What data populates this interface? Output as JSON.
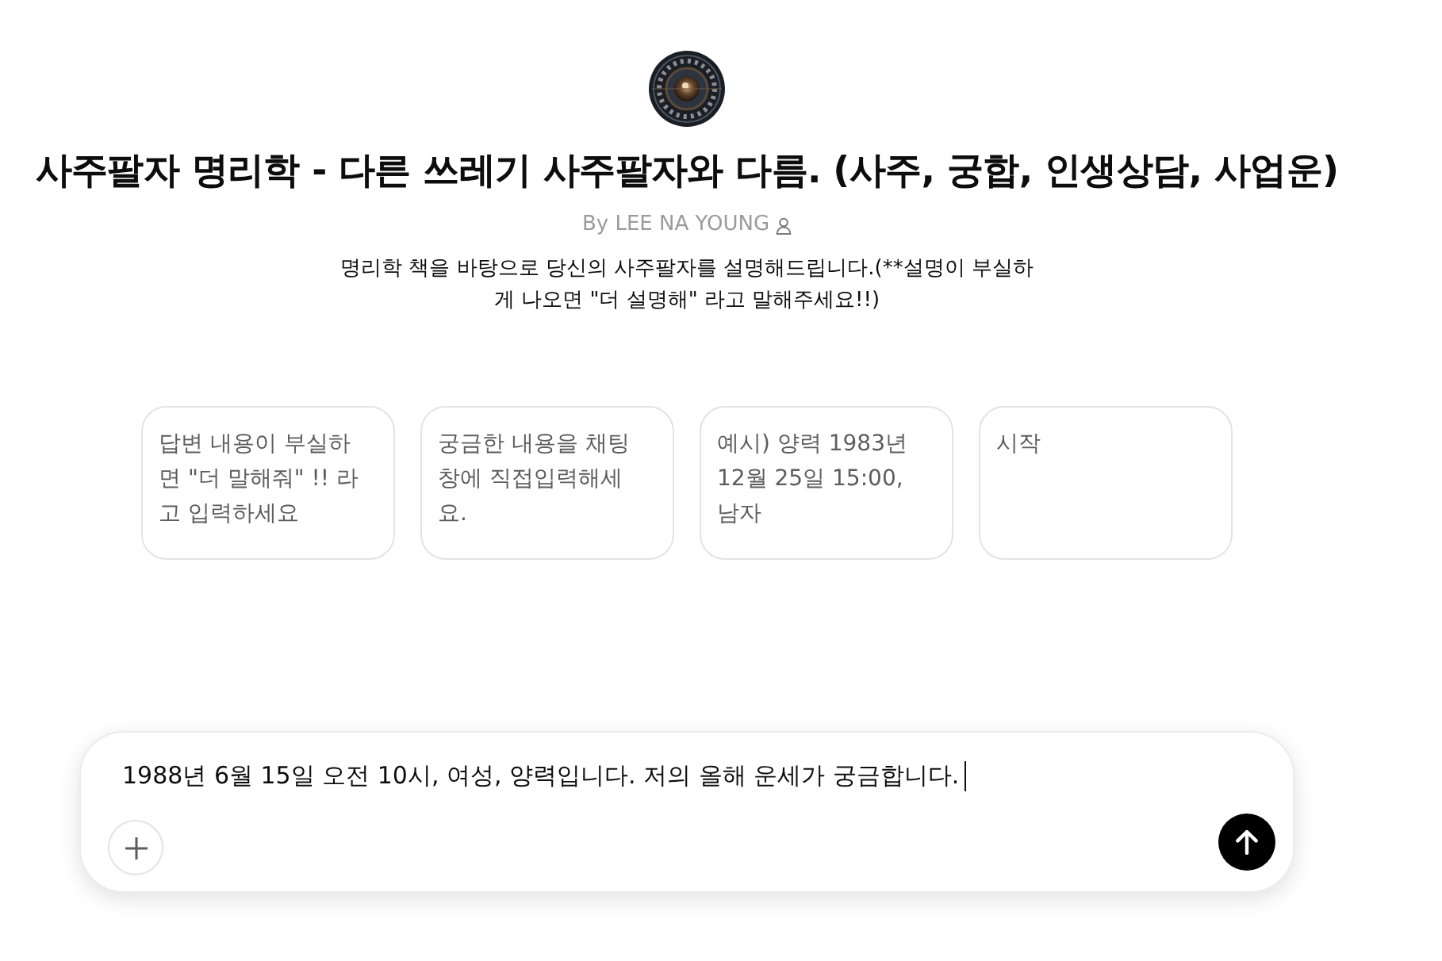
{
  "profile": {
    "title": "사주팔자 명리학 - 다른 쓰레기 사주팔자와 다름. (사주, 궁합, 인생상담, 사업운)",
    "author": "By LEE NA YOUNG",
    "description": "명리학 책을 바탕으로 당신의 사주팔자를 설명해드립니다.(**설명이 부실하게 나오면 \"더 설명해\" 라고 말해주세요!!)"
  },
  "starters": [
    {
      "text": "답변 내용이 부실하면 \"더 말해줘\" !! 라고 입력하세요"
    },
    {
      "text": "궁금한 내용을 채팅창에 직접입력해세요."
    },
    {
      "text": "예시) 양력 1983년 12월 25일 15:00, 남자"
    },
    {
      "text": "시작"
    }
  ],
  "composer": {
    "value": "1988년 6월 15일 오전 10시, 여성, 양력입니다. 저의 올해 운세가 궁금합니다."
  }
}
